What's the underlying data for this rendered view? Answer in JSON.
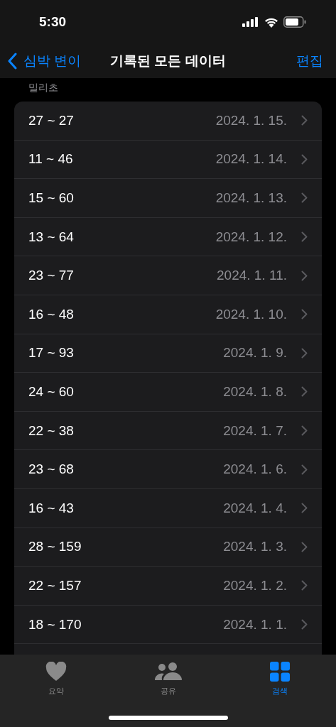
{
  "status_bar": {
    "time": "5:30"
  },
  "nav": {
    "back": "심박 변이",
    "title": "기록된 모든 데이터",
    "action": "편집"
  },
  "section_header": "밀리초",
  "rows": [
    {
      "range": "27 ~ 27",
      "date": "2024. 1. 15."
    },
    {
      "range": "11 ~ 46",
      "date": "2024. 1. 14."
    },
    {
      "range": "15 ~ 60",
      "date": "2024. 1. 13."
    },
    {
      "range": "13 ~ 64",
      "date": "2024. 1. 12."
    },
    {
      "range": "23 ~ 77",
      "date": "2024. 1. 11."
    },
    {
      "range": "16 ~ 48",
      "date": "2024. 1. 10."
    },
    {
      "range": "17 ~ 93",
      "date": "2024. 1. 9."
    },
    {
      "range": "24 ~ 60",
      "date": "2024. 1. 8."
    },
    {
      "range": "22 ~ 38",
      "date": "2024. 1. 7."
    },
    {
      "range": "23 ~ 68",
      "date": "2024. 1. 6."
    },
    {
      "range": "16 ~ 43",
      "date": "2024. 1. 4."
    },
    {
      "range": "28 ~ 159",
      "date": "2024. 1. 3."
    },
    {
      "range": "22 ~ 157",
      "date": "2024. 1. 2."
    },
    {
      "range": "18 ~ 170",
      "date": "2024. 1. 1."
    }
  ],
  "tab_bar": [
    {
      "label": "요약",
      "kind": "heart",
      "selected": false
    },
    {
      "label": "공유",
      "kind": "people",
      "selected": false
    },
    {
      "label": "검색",
      "kind": "grid",
      "selected": true
    }
  ]
}
